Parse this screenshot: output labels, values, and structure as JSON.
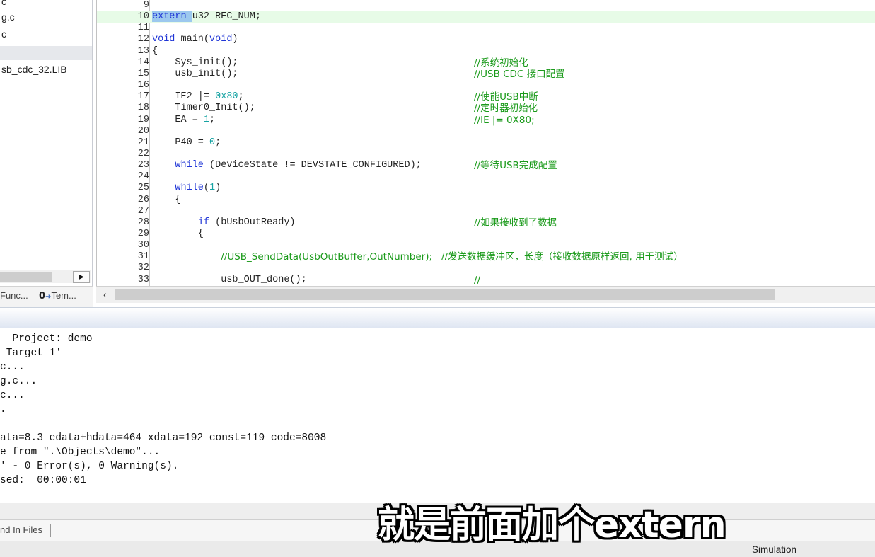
{
  "project_tree": {
    "items": [
      {
        "label": "c",
        "selected": false
      },
      {
        "label": "g.c",
        "selected": false
      },
      {
        "label": "c",
        "selected": false
      },
      {
        "label": "",
        "selected": true
      },
      {
        "label": "sb_cdc_32.LIB",
        "selected": false
      }
    ],
    "tabs": [
      {
        "label": "Func...",
        "icon": "function-icon"
      },
      {
        "label": "Tem...",
        "icon": "template-icon"
      }
    ]
  },
  "editor": {
    "lines": [
      {
        "n": "9",
        "code": "",
        "comment": ""
      },
      {
        "n": "10",
        "code": "extern u32 REC_NUM;",
        "comment": "",
        "current": true
      },
      {
        "n": "11",
        "code": "",
        "comment": ""
      },
      {
        "n": "12",
        "code": "void main(void)",
        "comment": ""
      },
      {
        "n": "13",
        "code": "{",
        "comment": ""
      },
      {
        "n": "14",
        "code": "    Sys_init();",
        "comment": "//系统初始化"
      },
      {
        "n": "15",
        "code": "    usb_init();",
        "comment": "//USB CDC 接口配置"
      },
      {
        "n": "16",
        "code": "",
        "comment": ""
      },
      {
        "n": "17",
        "code": "    IE2 |= 0x80;",
        "comment": "//使能USB中断"
      },
      {
        "n": "18",
        "code": "    Timer0_Init();",
        "comment": "//定时器初始化"
      },
      {
        "n": "19",
        "code": "    EA = 1;",
        "comment": "//IE |= 0X80;"
      },
      {
        "n": "20",
        "code": "",
        "comment": ""
      },
      {
        "n": "21",
        "code": "    P40 = 0;",
        "comment": ""
      },
      {
        "n": "22",
        "code": "",
        "comment": ""
      },
      {
        "n": "23",
        "code": "    while (DeviceState != DEVSTATE_CONFIGURED);",
        "comment": "//等待USB完成配置"
      },
      {
        "n": "24",
        "code": "",
        "comment": ""
      },
      {
        "n": "25",
        "code": "    while(1)",
        "comment": ""
      },
      {
        "n": "26",
        "code": "    {",
        "comment": ""
      },
      {
        "n": "27",
        "code": "",
        "comment": ""
      },
      {
        "n": "28",
        "code": "        if (bUsbOutReady)",
        "comment": "//如果接收到了数据"
      },
      {
        "n": "29",
        "code": "        {",
        "comment": ""
      },
      {
        "n": "30",
        "code": "",
        "comment": ""
      },
      {
        "n": "31",
        "code": "            //USB_SendData(UsbOutBuffer,OutNumber);   //发送数据缓冲区，长度（接收数据原样返回, 用于测试）",
        "comment": ""
      },
      {
        "n": "32",
        "code": "",
        "comment": ""
      },
      {
        "n": "33",
        "code": "            usb_OUT_done();",
        "comment": "//"
      }
    ]
  },
  "build_output": {
    "lines": [
      "  Project: demo",
      " Target 1'",
      "c...",
      "g.c...",
      "c...",
      ".",
      "",
      "ata=8.3 edata+hdata=464 xdata=192 const=119 code=8008",
      "e from \".\\Objects\\demo\"...",
      "' - 0 Error(s), 0 Warning(s).",
      "sed:  00:00:01"
    ]
  },
  "bottom_tabs": {
    "find_in_files": "nd In Files"
  },
  "status_bar": {
    "mode": "Simulation"
  },
  "subtitle": "就是前面加个extern"
}
